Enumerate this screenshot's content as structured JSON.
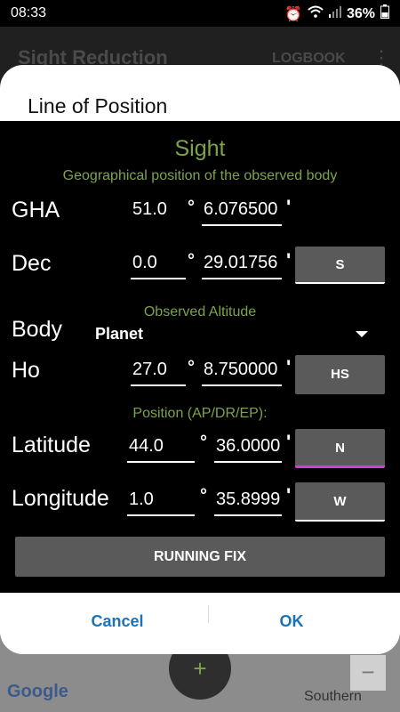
{
  "status": {
    "time": "08:33",
    "battery": "36%",
    "icons": [
      "alarm-icon",
      "wifi-icon",
      "signal-icon",
      "battery-icon"
    ]
  },
  "appbar": {
    "title": "Sight Reduction",
    "logbook": "LOGBOOK",
    "menu_icon": "⋮"
  },
  "map": {
    "logo": "Google",
    "label": "Southern",
    "fab_icon": "+",
    "zoom_out": "−"
  },
  "dialog": {
    "title": "Line of Position",
    "sight_title": "Sight",
    "sight_subtitle": "Geographical position of the observed body",
    "gha": {
      "label": "GHA",
      "deg": "51.0",
      "min": "6.076500"
    },
    "dec": {
      "label": "Dec",
      "deg": "0.0",
      "min": "29.01756",
      "hemisphere": "S"
    },
    "observed_altitude": "Observed Altitude",
    "body": {
      "label": "Body",
      "value": "Planet"
    },
    "ho": {
      "label": "Ho",
      "deg": "27.0",
      "min": "8.750000",
      "mode": "HS"
    },
    "position_label": "Position (AP/DR/EP):",
    "latitude": {
      "label": "Latitude",
      "deg": "44.0",
      "min": "36.0000",
      "hemisphere": "N"
    },
    "longitude": {
      "label": "Longitude",
      "deg": "1.0",
      "min": "35.8999",
      "hemisphere": "W"
    },
    "running_fix": "RUNNING FIX",
    "cancel": "Cancel",
    "ok": "OK",
    "degree_symbol": "°",
    "minute_symbol": "'"
  },
  "colors": {
    "accent_green": "#7da34a",
    "button_gray": "#5a5a5a",
    "action_blue": "#1a73b8",
    "selected_underline": "#d63bd6"
  }
}
